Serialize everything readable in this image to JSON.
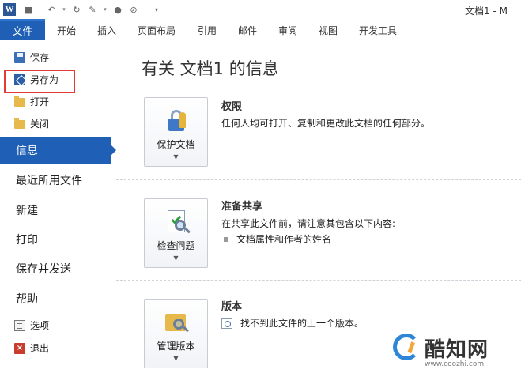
{
  "app": {
    "logo_letter": "W",
    "window_title": "文档1 - M"
  },
  "qat": {
    "items": [
      "save-icon",
      "undo-icon",
      "redo-icon",
      "format-painter-icon",
      "record-icon",
      "no-format-icon",
      "customize-icon"
    ]
  },
  "tabs": [
    "开始",
    "插入",
    "页面布局",
    "引用",
    "邮件",
    "审阅",
    "视图",
    "开发工具"
  ],
  "file_tab_label": "文件",
  "nav": {
    "save": "保存",
    "save_as": "另存为",
    "open": "打开",
    "close": "关闭",
    "info": "信息",
    "recent": "最近所用文件",
    "new": "新建",
    "print": "打印",
    "save_send": "保存并发送",
    "help": "帮助",
    "options": "选项",
    "exit": "退出"
  },
  "main": {
    "title": "有关 文档1 的信息",
    "permissions": {
      "button_label": "保护文档",
      "title": "权限",
      "desc": "任何人均可打开、复制和更改此文档的任何部分。"
    },
    "prepare": {
      "button_label": "检查问题",
      "title": "准备共享",
      "desc": "在共享此文件前，请注意其包含以下内容:",
      "bullet": "文档属性和作者的姓名"
    },
    "versions": {
      "button_label": "管理版本",
      "title": "版本",
      "desc": "找不到此文件的上一个版本。"
    }
  },
  "watermark": {
    "text": "酷知网",
    "url": "www.coozhi.com"
  },
  "colors": {
    "accent": "#1f5fb5",
    "highlight_box": "#e53935"
  }
}
